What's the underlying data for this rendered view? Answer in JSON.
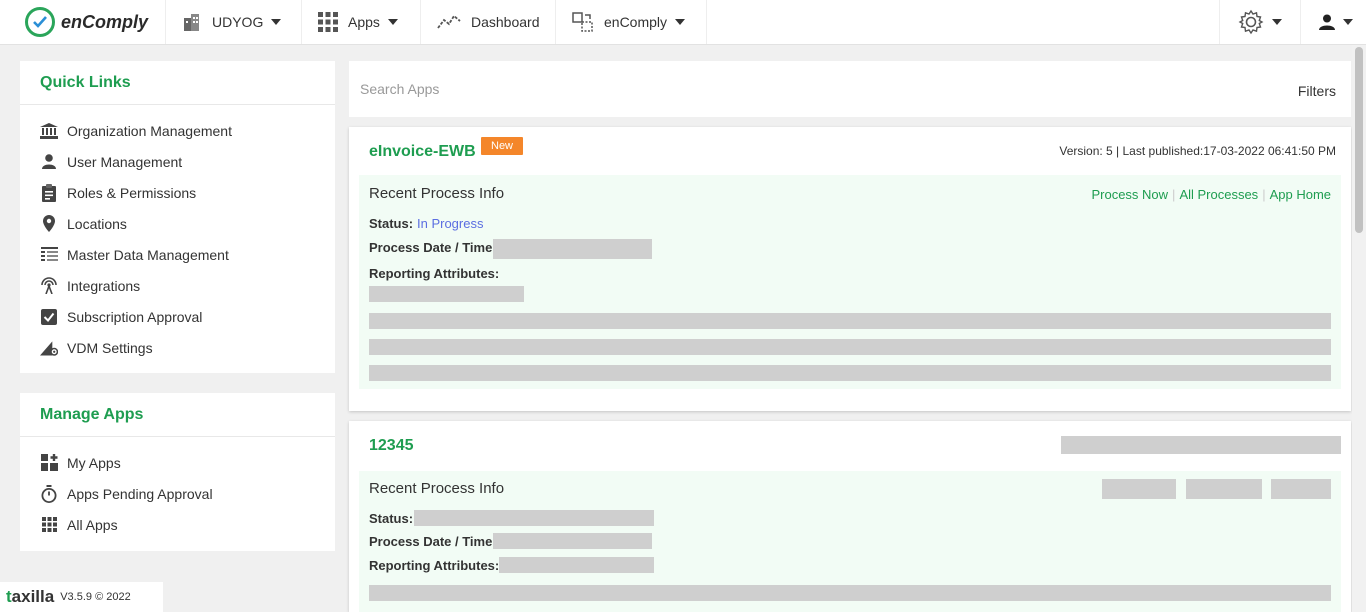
{
  "brand": {
    "name": "enComply",
    "color": "#1e9d50"
  },
  "nav": {
    "org": "UDYOG",
    "apps": "Apps",
    "dashboard": "Dashboard",
    "product": "enComply"
  },
  "quick_links": {
    "title": "Quick Links",
    "items": [
      {
        "label": "Organization Management",
        "icon": "bank-icon"
      },
      {
        "label": "User Management",
        "icon": "user-icon"
      },
      {
        "label": "Roles & Permissions",
        "icon": "clipboard-icon"
      },
      {
        "label": "Locations",
        "icon": "map-pin-icon"
      },
      {
        "label": "Master Data Management",
        "icon": "table-icon"
      },
      {
        "label": "Integrations",
        "icon": "broadcast-icon"
      },
      {
        "label": "Subscription Approval",
        "icon": "check-square-icon"
      },
      {
        "label": "VDM Settings",
        "icon": "settings-triangle-icon"
      }
    ]
  },
  "manage_apps": {
    "title": "Manage Apps",
    "items": [
      {
        "label": "My Apps",
        "icon": "apps-add-icon"
      },
      {
        "label": "Apps Pending Approval",
        "icon": "stopwatch-icon"
      },
      {
        "label": "All Apps",
        "icon": "grid-icon"
      }
    ]
  },
  "search": {
    "placeholder": "Search Apps",
    "filters_label": "Filters"
  },
  "apps": [
    {
      "title": "eInvoice-EWB",
      "badge": "New",
      "version": "Version: 5 | Last published:17-03-2022 06:41:50 PM",
      "recent_label": "Recent Process Info",
      "actions": [
        "Process Now",
        "All Processes",
        "App Home"
      ],
      "status_label": "Status:",
      "status_value": "In Progress",
      "date_label": "Process Date / Time:",
      "attr_label": "Reporting Attributes:"
    },
    {
      "title": "12345",
      "recent_label": "Recent Process Info",
      "status_label": "Status:",
      "date_label": "Process Date / Time:",
      "attr_label": "Reporting Attributes:"
    }
  ],
  "footer": {
    "logo": "taxilla",
    "version": "V3.5.9 © 2022"
  },
  "colors": {
    "accent": "#1e9d50",
    "badge": "#f4862a",
    "status": "#5b6ee1",
    "info_bg": "#f2fcf5"
  }
}
